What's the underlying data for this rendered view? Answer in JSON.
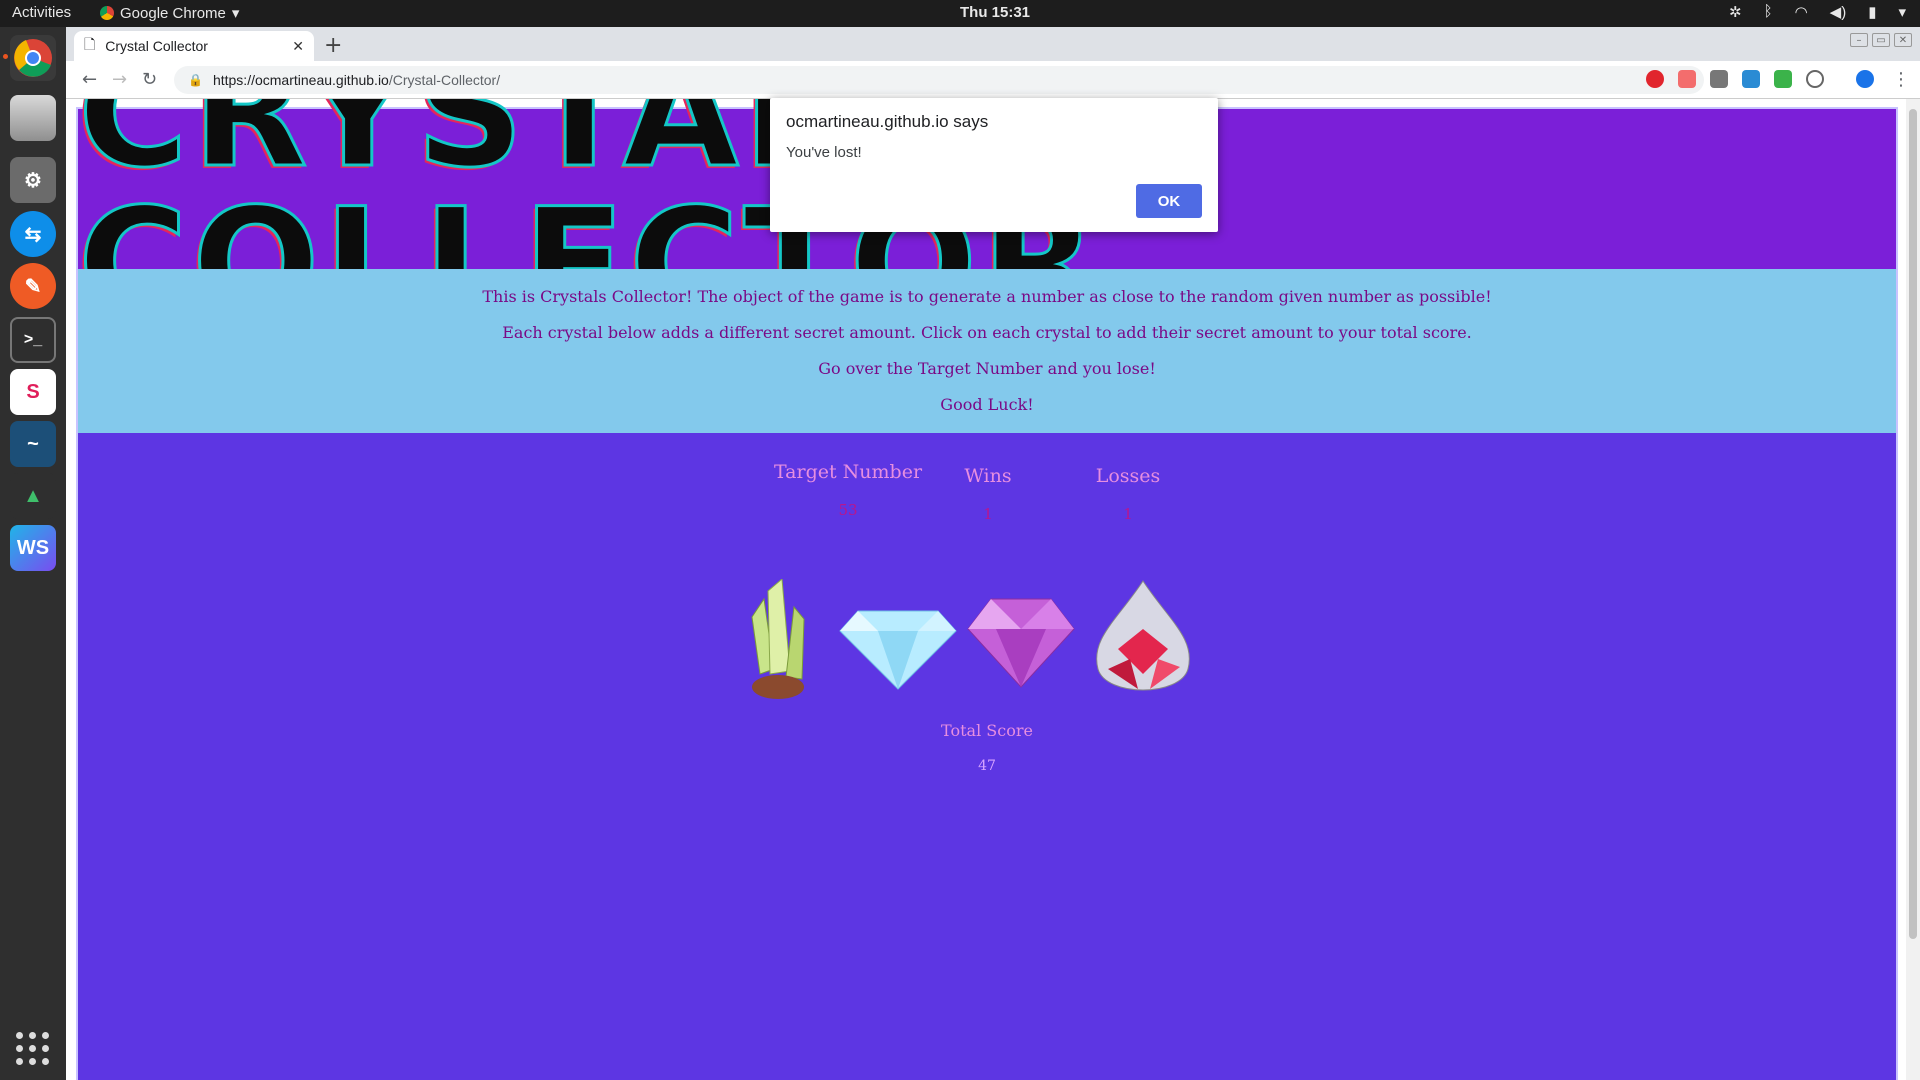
{
  "system": {
    "activities": "Activities",
    "app_name": "Google Chrome",
    "clock": "Thu 15:31"
  },
  "browser": {
    "tab_title": "Crystal Collector",
    "url_host": "https://ocmartineau.github.io",
    "url_path": "/Crystal-Collector/"
  },
  "page": {
    "title": "CRYSTALS COLLECTOR",
    "intro": [
      "This is Crystals Collector! The object of the game is to generate a number as close to the random given number as possible!",
      "Each crystal below adds a different secret amount. Click on each crystal to add their secret amount to your total score.",
      "Go over the Target Number and you lose!",
      "Good Luck!"
    ],
    "stats": {
      "target_label": "Target Number",
      "target_value": "53",
      "wins_label": "Wins",
      "wins_value": "1",
      "losses_label": "Losses",
      "losses_value": "1"
    },
    "score": {
      "label": "Total Score",
      "value": "47"
    }
  },
  "dialog": {
    "title": "ocmartineau.github.io says",
    "message": "You've lost!",
    "ok_label": "OK"
  },
  "colors": {
    "page_bg": "#5d36e3",
    "header_bg": "#7b1fd8",
    "info_bg": "#83c9ec",
    "ok_button": "#4f6be4"
  }
}
